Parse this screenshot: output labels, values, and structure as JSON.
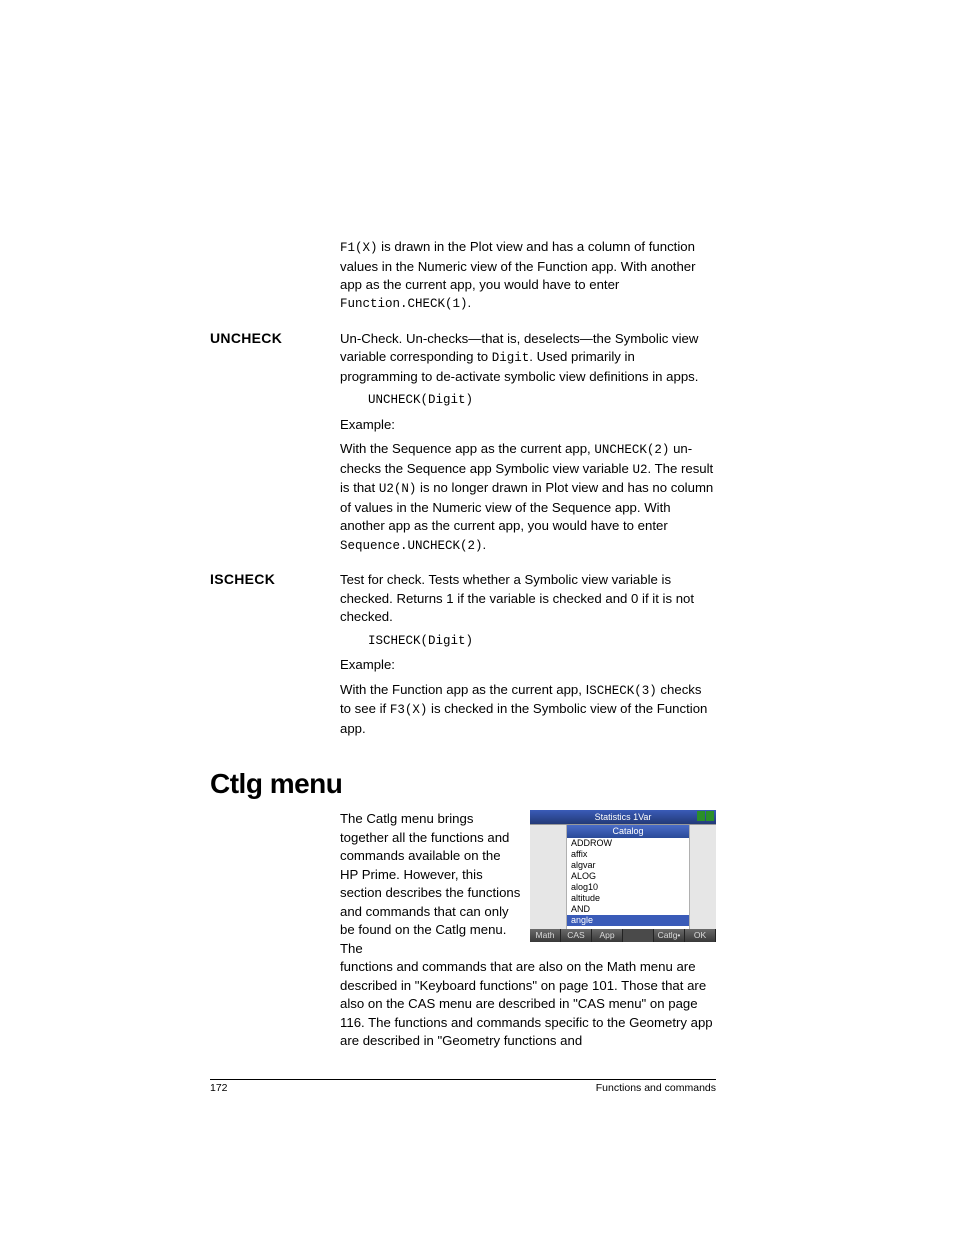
{
  "intro": {
    "p1_a": "F1(X)",
    "p1_b": " is drawn in the Plot view and has a column of function values in the Numeric view of the Function app. With another app as the current app, you would have to enter ",
    "p1_c": "Function.CHECK(1)",
    "p1_d": "."
  },
  "uncheck": {
    "label": "UNCHECK",
    "p1_a": "Un-Check. Un-checks—that is, deselects—the Symbolic view variable corresponding to ",
    "p1_b": "Digit",
    "p1_c": ". Used primarily in programming to de-activate symbolic view definitions in apps.",
    "syntax": "UNCHECK(Digit)",
    "ex_label": "Example:",
    "p2_a": "With the Sequence app as the current app, ",
    "p2_b": "UNCHECK(2)",
    "p2_c": " un-checks the Sequence app Symbolic view variable ",
    "p2_d": "U2",
    "p2_e": ". The result is that ",
    "p2_f": "U2(N)",
    "p2_g": " is no longer drawn in Plot view and has no column of values in the Numeric view of the Sequence app. With another app as the current app, you would have to enter ",
    "p2_h": "Sequence.UNCHECK(2)",
    "p2_i": "."
  },
  "ischeck": {
    "label": "ISCHECK",
    "p1": "Test for check. Tests whether a Symbolic view variable is checked. Returns 1 if the variable is checked and 0 if it is not checked.",
    "syntax": "ISCHECK(Digit)",
    "ex_label": "Example:",
    "p2_a": "With the Function app as the current app, I",
    "p2_b": "SCHECK(3)",
    "p2_c": " checks to see if ",
    "p2_d": "F3(X)",
    "p2_e": " is checked in the Symbolic view of the Function app."
  },
  "ctlg": {
    "heading": "Ctlg menu",
    "intro": "The Catlg menu brings together all the functions and commands available on the HP Prime. However, this section describes the functions and commands that can only be found on the Catlg menu. The ",
    "cont": "functions and commands that are also on the Math menu are described in \"Keyboard functions\" on page 101. Those that are also on the CAS menu are described in \"CAS menu\" on page 116. The functions and commands specific to the Geometry app are described in \"Geometry functions and"
  },
  "screenshot": {
    "title": "Statistics 1Var",
    "catalog": "Catalog",
    "items": [
      "ADDROW",
      "affix",
      "algvar",
      "ALOG",
      "alog10",
      "altitude",
      "AND",
      "angle"
    ],
    "softkeys": [
      "Math",
      "CAS",
      "App",
      "",
      "Catlg•",
      "OK"
    ]
  },
  "footer": {
    "page": "172",
    "section": "Functions and commands"
  }
}
